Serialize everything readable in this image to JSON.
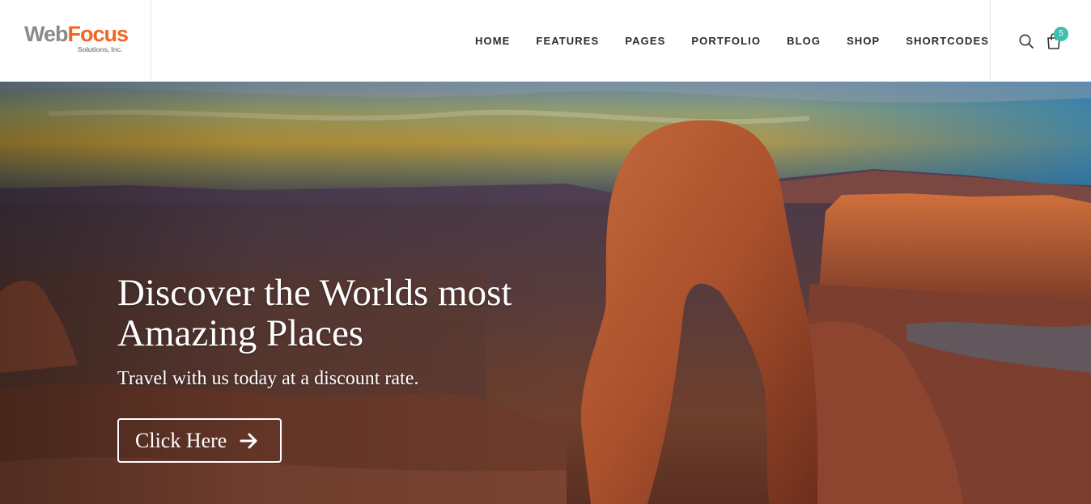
{
  "brand": {
    "name_part1": "Web",
    "name_part2": "Focus",
    "tagline": "Solutions, Inc.",
    "colors": {
      "gray": "#8a8a8a",
      "orange": "#f26522"
    }
  },
  "nav": {
    "items": [
      {
        "label": "HOME"
      },
      {
        "label": "FEATURES"
      },
      {
        "label": "PAGES"
      },
      {
        "label": "PORTFOLIO"
      },
      {
        "label": "BLOG"
      },
      {
        "label": "SHOP"
      },
      {
        "label": "SHORTCODES"
      }
    ]
  },
  "header_icons": {
    "search_icon": "search-icon",
    "cart_icon": "shopping-bag-icon",
    "cart_count": "5",
    "badge_color": "#3fbfae"
  },
  "hero": {
    "title": "Discover the Worlds most Amazing Places",
    "subtitle": "Travel with us today at a discount rate.",
    "button_label": "Click Here",
    "button_icon": "arrow-right-icon",
    "background": "desert-arch-sunset-image"
  }
}
